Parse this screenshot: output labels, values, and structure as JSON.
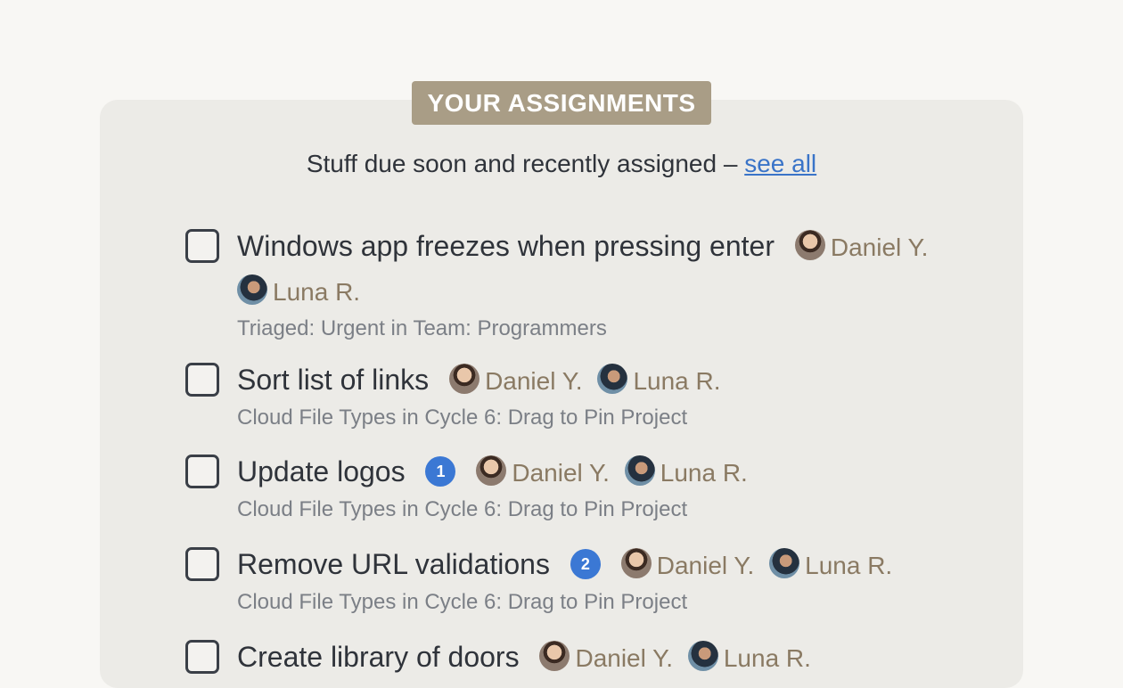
{
  "section": {
    "tag": "YOUR ASSIGNMENTS",
    "subtitle": "Stuff due soon and recently assigned –",
    "see_all": "see all"
  },
  "assignments": [
    {
      "title": "Windows app freezes when pressing enter",
      "badge": null,
      "assignees": [
        "Daniel Y.",
        "Luna R."
      ],
      "meta": "Triaged: Urgent in Team: Programmers"
    },
    {
      "title": "Sort list of links",
      "badge": null,
      "assignees": [
        "Daniel Y.",
        "Luna R."
      ],
      "meta": "Cloud File Types in Cycle 6: Drag to Pin Project"
    },
    {
      "title": "Update logos",
      "badge": "1",
      "assignees": [
        "Daniel Y.",
        "Luna R."
      ],
      "meta": "Cloud File Types in Cycle 6: Drag to Pin Project"
    },
    {
      "title": "Remove URL validations",
      "badge": "2",
      "assignees": [
        "Daniel Y.",
        "Luna R."
      ],
      "meta": "Cloud File Types in Cycle 6: Drag to Pin Project"
    },
    {
      "title": "Create library of doors",
      "badge": null,
      "assignees": [
        "Daniel Y.",
        "Luna R."
      ],
      "meta": ""
    }
  ],
  "colors": {
    "tag_bg": "#a99d86",
    "panel_bg": "#ecebe7",
    "link": "#3a74c8",
    "badge": "#3b78d4",
    "assignee": "#8a7a63"
  }
}
